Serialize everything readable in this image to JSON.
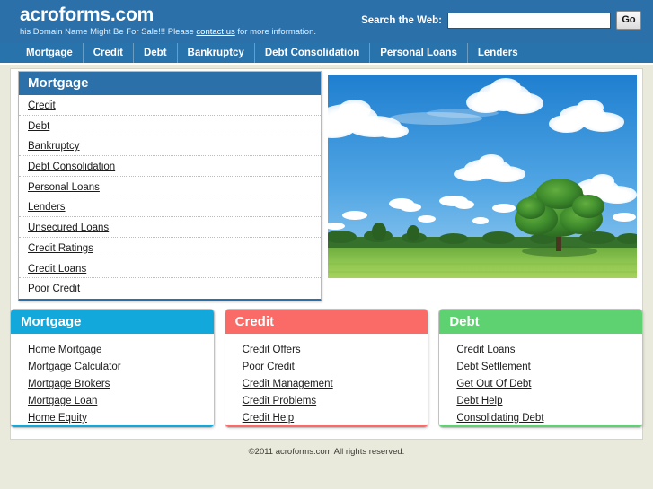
{
  "header": {
    "brand": "acroforms.com",
    "tagline_prefix": "his Domain Name Might Be For Sale!!! Please ",
    "tagline_link": "contact us",
    "tagline_suffix": " for more information.",
    "search_label": "Search the Web:",
    "search_value": "",
    "search_placeholder": "",
    "go_label": "Go",
    "bg_color": "#2b70a9"
  },
  "nav": {
    "items": [
      {
        "label": "Mortgage"
      },
      {
        "label": "Credit"
      },
      {
        "label": "Debt"
      },
      {
        "label": "Bankruptcy"
      },
      {
        "label": "Debt Consolidation"
      },
      {
        "label": "Personal Loans"
      },
      {
        "label": "Lenders"
      }
    ]
  },
  "sidebar": {
    "title": "Mortgage",
    "header_color": "#2b70a9",
    "items": [
      {
        "label": "Credit"
      },
      {
        "label": "Debt"
      },
      {
        "label": "Bankruptcy"
      },
      {
        "label": "Debt Consolidation"
      },
      {
        "label": "Personal Loans"
      },
      {
        "label": "Lenders"
      },
      {
        "label": "Unsecured Loans"
      },
      {
        "label": "Credit Ratings"
      },
      {
        "label": "Credit Loans"
      },
      {
        "label": "Poor Credit"
      }
    ]
  },
  "hero": {
    "alt": "Green field with single tree under blue sky with white clouds"
  },
  "boxes": [
    {
      "title": "Mortgage",
      "color": "#12a8dc",
      "items": [
        {
          "label": "Home Mortgage"
        },
        {
          "label": "Mortgage Calculator"
        },
        {
          "label": "Mortgage Brokers"
        },
        {
          "label": "Mortgage Loan"
        },
        {
          "label": "Home Equity"
        }
      ]
    },
    {
      "title": "Credit",
      "color": "#fa6a66",
      "items": [
        {
          "label": "Credit Offers"
        },
        {
          "label": "Poor Credit"
        },
        {
          "label": "Credit Management"
        },
        {
          "label": "Credit Problems"
        },
        {
          "label": "Credit Help"
        }
      ]
    },
    {
      "title": "Debt",
      "color": "#5ed271",
      "items": [
        {
          "label": "Credit Loans"
        },
        {
          "label": "Debt Settlement"
        },
        {
          "label": "Get Out Of Debt"
        },
        {
          "label": "Debt Help"
        },
        {
          "label": "Consolidating Debt"
        }
      ]
    }
  ],
  "footer": {
    "text": "©2011 acroforms.com All rights reserved."
  }
}
